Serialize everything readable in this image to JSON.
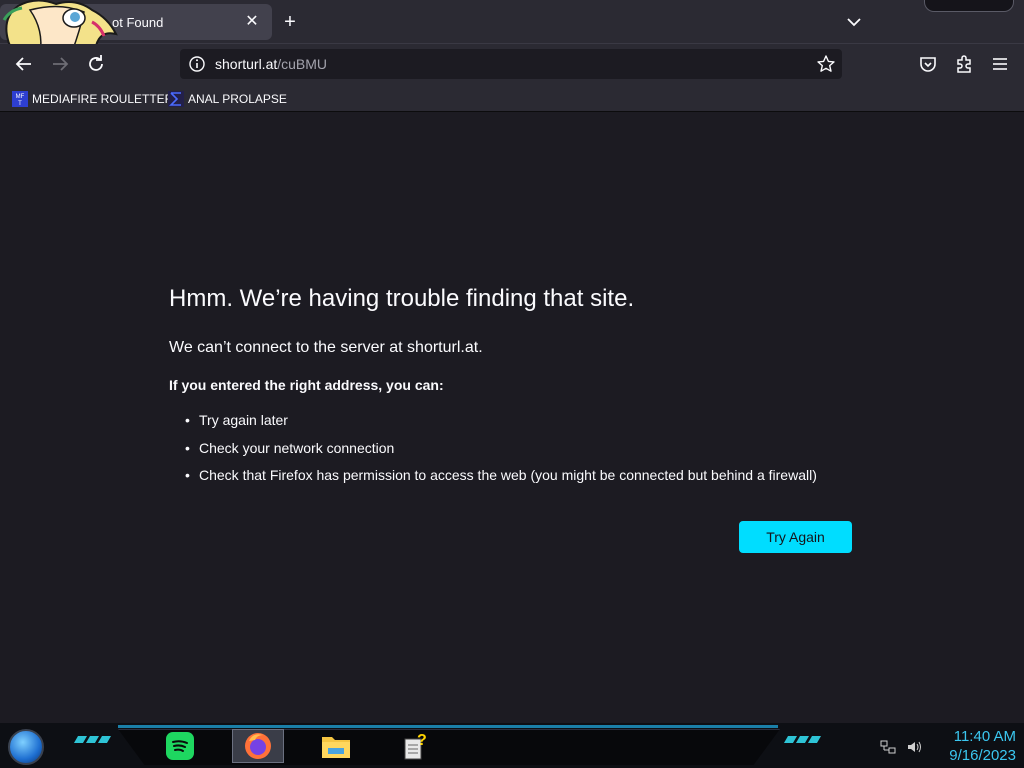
{
  "browser": {
    "tab": {
      "title": "ot Found",
      "close_glyph": "✕"
    },
    "new_tab_glyph": "+",
    "url": {
      "host": "shorturl.at",
      "path": "/cuBMU"
    },
    "bookmarks": [
      {
        "label": "MEDIAFIRE ROULETTER",
        "favicon_text": "MF T"
      },
      {
        "label": "ANAL PROLAPSE"
      }
    ]
  },
  "error": {
    "title": "Hmm. We’re having trouble finding that site.",
    "subtitle": "We can’t connect to the server at shorturl.at.",
    "hint": "If you entered the right address, you can:",
    "suggestions": [
      "Try again later",
      "Check your network connection",
      "Check that Firefox has permission to access the web (you might be connected but behind a firewall)"
    ],
    "try_again_label": "Try Again"
  },
  "taskbar": {
    "apps": [
      "spotify",
      "firefox",
      "file-explorer",
      "help-notepad"
    ],
    "active_app": "firefox",
    "time": "11:40 AM",
    "date": "9/16/2023"
  },
  "colors": {
    "accent": "#00ddff",
    "clock": "#3bc7f0",
    "page_bg": "#1c1b22",
    "toolbar_bg": "#2b2a33"
  }
}
